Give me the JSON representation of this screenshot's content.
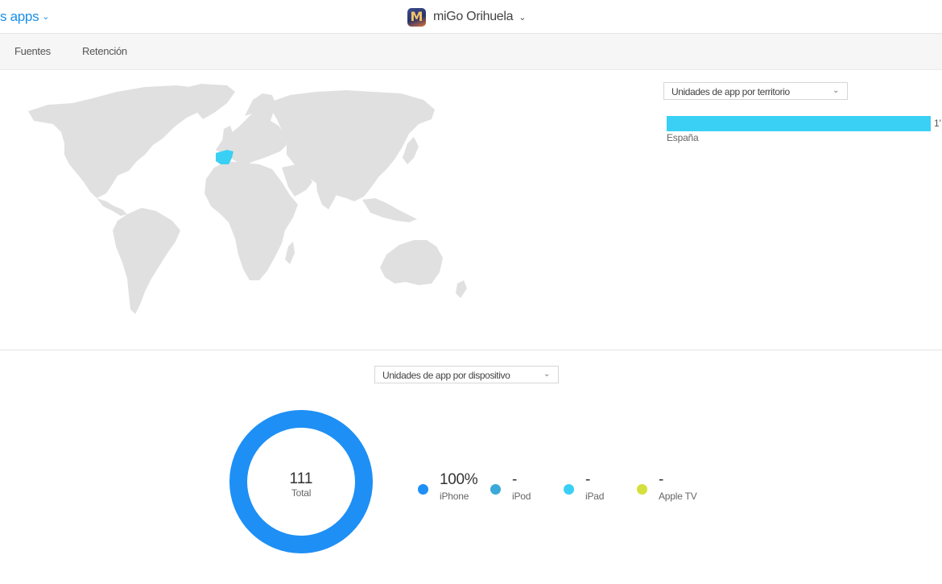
{
  "header": {
    "apps_link_label": "s apps",
    "app_name": "miGo Orihuela",
    "app_icon_letter": "M"
  },
  "subnav": {
    "tabs": [
      {
        "label": "Fuentes"
      },
      {
        "label": "Retención"
      }
    ]
  },
  "territory": {
    "dropdown_label": "Unidades de app por territorio",
    "highlight_color": "#3ad0f5",
    "bars": [
      {
        "label": "España",
        "value_text": "1'"
      }
    ]
  },
  "device": {
    "dropdown_label": "Unidades de app por dispositivo",
    "total_value": "111",
    "total_label": "Total",
    "legend": [
      {
        "value": "100%",
        "name": "iPhone",
        "color": "#1e8ff5"
      },
      {
        "value": "-",
        "name": "iPod",
        "color": "#3aa9d8"
      },
      {
        "value": "-",
        "name": "iPad",
        "color": "#3ad0f5"
      },
      {
        "value": "-",
        "name": "Apple TV",
        "color": "#d4e03c"
      }
    ]
  },
  "chart_data": {
    "type": "pie",
    "categories": [
      "iPhone",
      "iPod",
      "iPad",
      "Apple TV"
    ],
    "values": [
      100,
      0,
      0,
      0
    ],
    "total": 111
  }
}
